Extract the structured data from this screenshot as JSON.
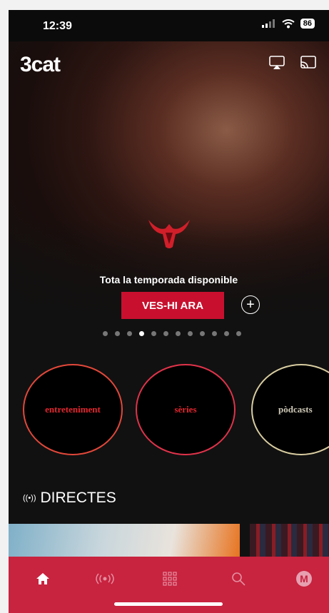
{
  "status_bar": {
    "time": "12:39",
    "battery": "86"
  },
  "header": {
    "logo_text": "3cat"
  },
  "hero": {
    "tagline": "Tota la temporada disponible",
    "cta_label": "VES-HI ARA",
    "add_label": "+",
    "carousel": {
      "total": 12,
      "active_index": 3
    }
  },
  "categories": [
    {
      "label": "entreteniment"
    },
    {
      "label": "sèries"
    },
    {
      "label": "pòdcasts"
    }
  ],
  "section": {
    "title": "DIRECTES",
    "icon": "live-radio-icon"
  },
  "nav": {
    "items": [
      {
        "icon": "home-icon",
        "active": true
      },
      {
        "icon": "live-icon"
      },
      {
        "icon": "grid-icon"
      },
      {
        "icon": "search-icon"
      },
      {
        "icon": "avatar",
        "initial": "M"
      }
    ]
  },
  "colors": {
    "accent": "#c8233f",
    "cta": "#c8102e",
    "category_text": "#e2262e"
  }
}
